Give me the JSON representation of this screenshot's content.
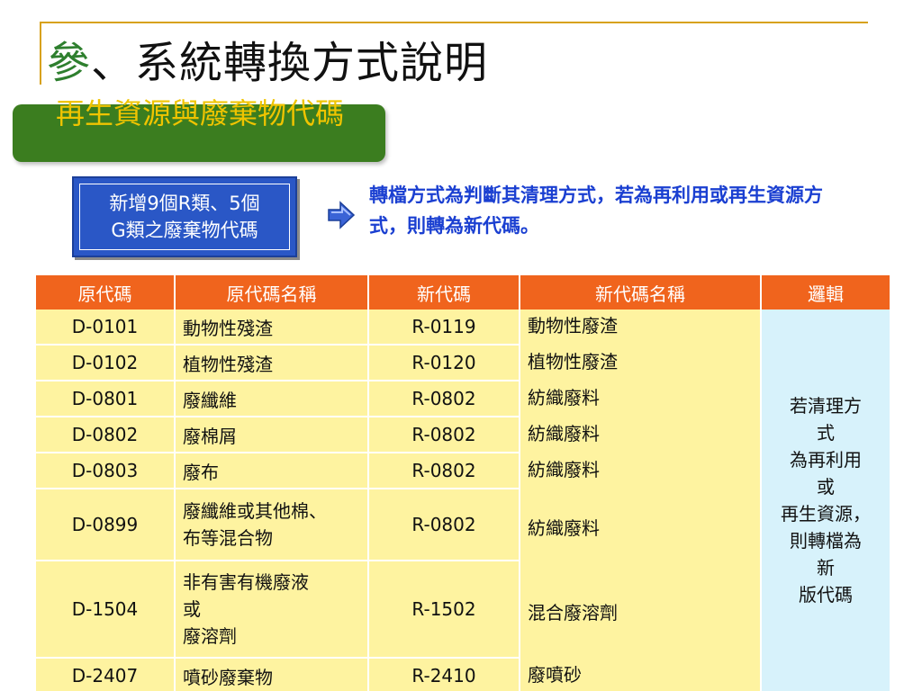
{
  "slide": {
    "title_prefix": "參",
    "title_rest": "、系統轉換方式說明",
    "section_label": "再生資源與廢棄物代碼"
  },
  "note_box": {
    "line1": "新增9個R類、5個",
    "line2": "G類之廢棄物代碼"
  },
  "conversion_note": "轉檔方式為判斷其清理方式，若為再利用或再生資源方式，則轉為新代碼。",
  "table": {
    "headers": [
      "原代碼",
      "原代碼名稱",
      "新代碼",
      "新代碼名稱",
      "邏輯"
    ],
    "rows": [
      {
        "code": "D-0101",
        "name": "動物性殘渣",
        "new_code": "R-0119",
        "new_name": "動物性廢渣"
      },
      {
        "code": "D-0102",
        "name": "植物性殘渣",
        "new_code": "R-0120",
        "new_name": "植物性廢渣"
      },
      {
        "code": "D-0801",
        "name": "廢纖維",
        "new_code": "R-0802",
        "new_name": "紡織廢料"
      },
      {
        "code": "D-0802",
        "name": "廢棉屑",
        "new_code": "R-0802",
        "new_name": "紡織廢料"
      },
      {
        "code": "D-0803",
        "name": "廢布",
        "new_code": "R-0802",
        "new_name": "紡織廢料"
      },
      {
        "code": "D-0899",
        "name_l1": "廢纖維或其他棉、",
        "name_l2": "布等混合物",
        "new_code": "R-0802",
        "new_name": "紡織廢料"
      },
      {
        "code": "D-1504",
        "name_l1": "非有害有機廢液",
        "name_l2": "或",
        "name_l3": "廢溶劑",
        "new_code": "R-1502",
        "new_name": "混合廢溶劑"
      },
      {
        "code": "D-2407",
        "name": "噴砂廢棄物",
        "new_code": "R-2410",
        "new_name": "廢噴砂"
      }
    ],
    "logic_lines": [
      "若清理方",
      "式",
      "為再利用",
      "或",
      "再生資源，",
      "則轉檔為",
      "新",
      "版代碼"
    ]
  },
  "colors": {
    "accent_rule": "#d7a11a",
    "pill_green": "#3b7d1f",
    "pill_text": "#f0c400",
    "note_blue": "#2a57c6",
    "header_orange": "#f0641d",
    "cell_yellow": "#fef3a0",
    "logic_cyan": "#d7f2fb",
    "conversion_text": "#1a3fd1"
  },
  "icons": {
    "arrow": "arrow-right-icon"
  }
}
